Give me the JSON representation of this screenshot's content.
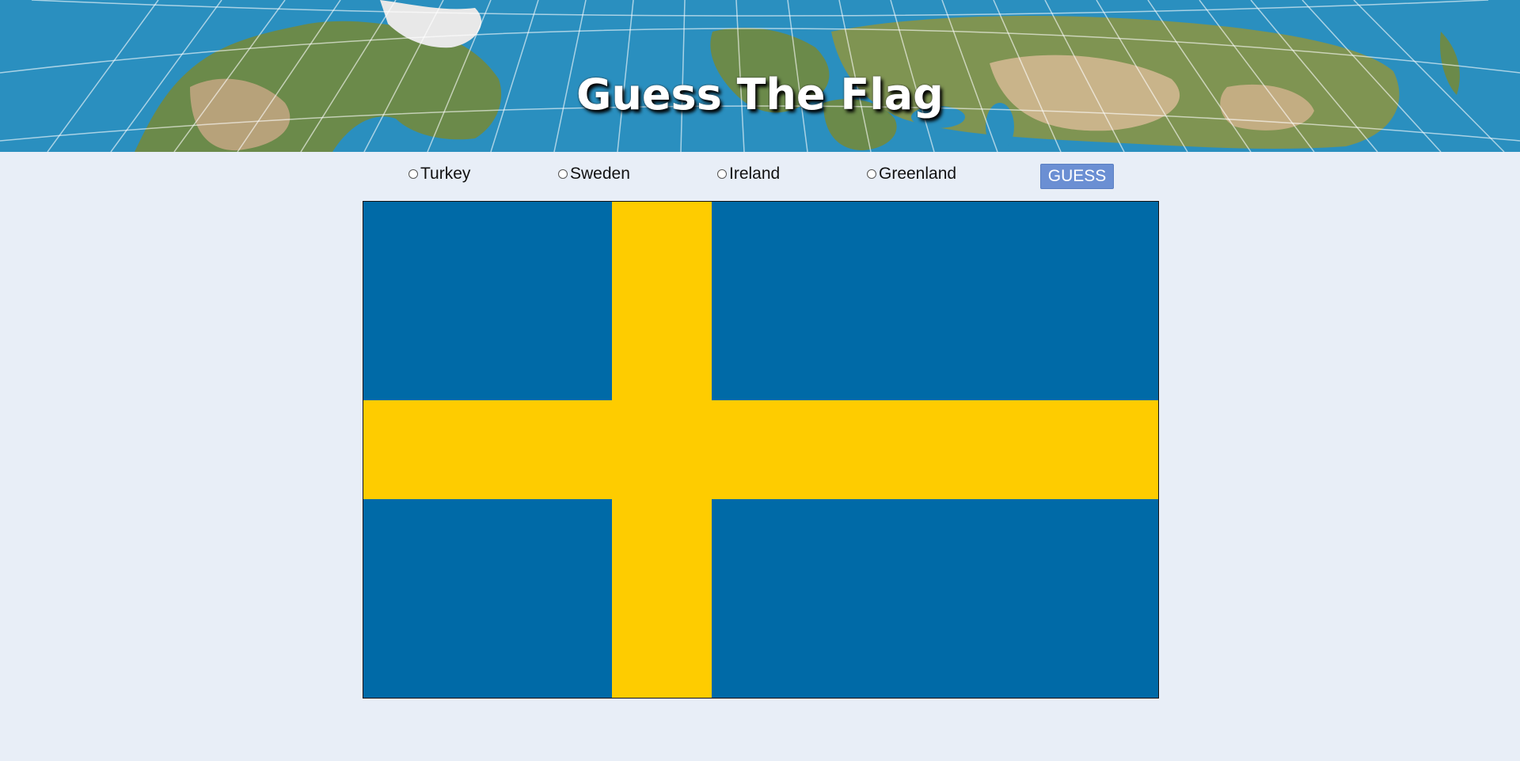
{
  "header": {
    "title": "Guess The Flag"
  },
  "options": [
    {
      "label": "Turkey",
      "selected": false
    },
    {
      "label": "Sweden",
      "selected": false
    },
    {
      "label": "Ireland",
      "selected": false
    },
    {
      "label": "Greenland",
      "selected": false
    }
  ],
  "guess_button": {
    "label": "GUESS"
  },
  "flag": {
    "country_colors": {
      "field": "#006aa7",
      "cross": "#fecc00"
    }
  },
  "colors": {
    "page_background": "#e8eef7",
    "button": "#6b8fd3",
    "ocean": "#2a8fbf",
    "land": "#6b8a4a"
  }
}
